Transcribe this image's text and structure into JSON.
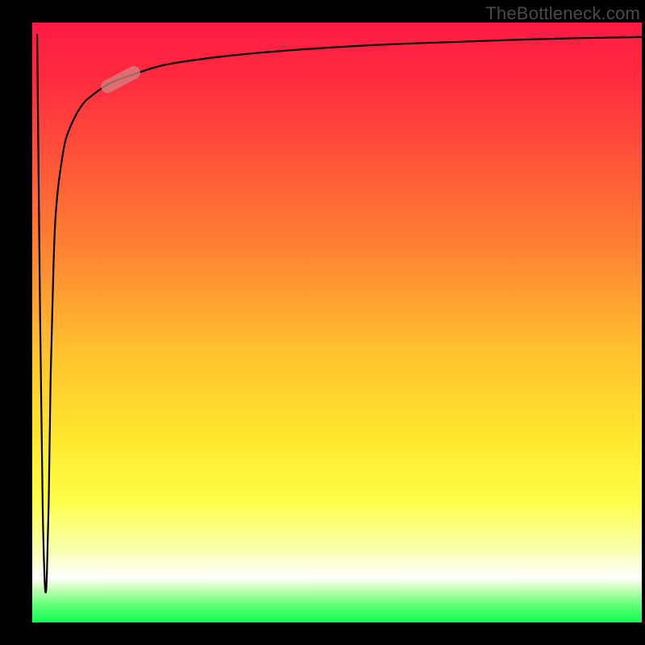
{
  "watermark": "TheBottleneck.com",
  "colors": {
    "frame": "#000000",
    "gradient_top": "#ff1a44",
    "gradient_mid": "#ffe92e",
    "gradient_bottom": "#10ff55",
    "curve": "#000000",
    "marker": "rgba(210,130,130,0.78)"
  },
  "chart_data": {
    "type": "line",
    "title": "",
    "xlabel": "",
    "ylabel": "",
    "xlim": [
      0,
      100
    ],
    "ylim": [
      0,
      100
    ],
    "grid": false,
    "legend": false,
    "series": [
      {
        "name": "curve",
        "x": [
          0.8,
          1.3,
          1.7,
          2.0,
          2.2,
          2.4,
          2.7,
          3.0,
          3.5,
          4.0,
          5.0,
          6.0,
          8.0,
          10.0,
          13.0,
          17.0,
          22.0,
          30.0,
          40.0,
          55.0,
          70.0,
          85.0,
          100.0
        ],
        "y": [
          98,
          50,
          20,
          8,
          5,
          8,
          20,
          40,
          60,
          70,
          78,
          82,
          86,
          88,
          90,
          91.5,
          93,
          94.2,
          95.2,
          96.2,
          96.8,
          97.3,
          97.6
        ]
      }
    ],
    "marker": {
      "x": 14.5,
      "y": 90.5,
      "angle_deg": 28,
      "length": 7
    },
    "xticks": [],
    "yticks": []
  }
}
